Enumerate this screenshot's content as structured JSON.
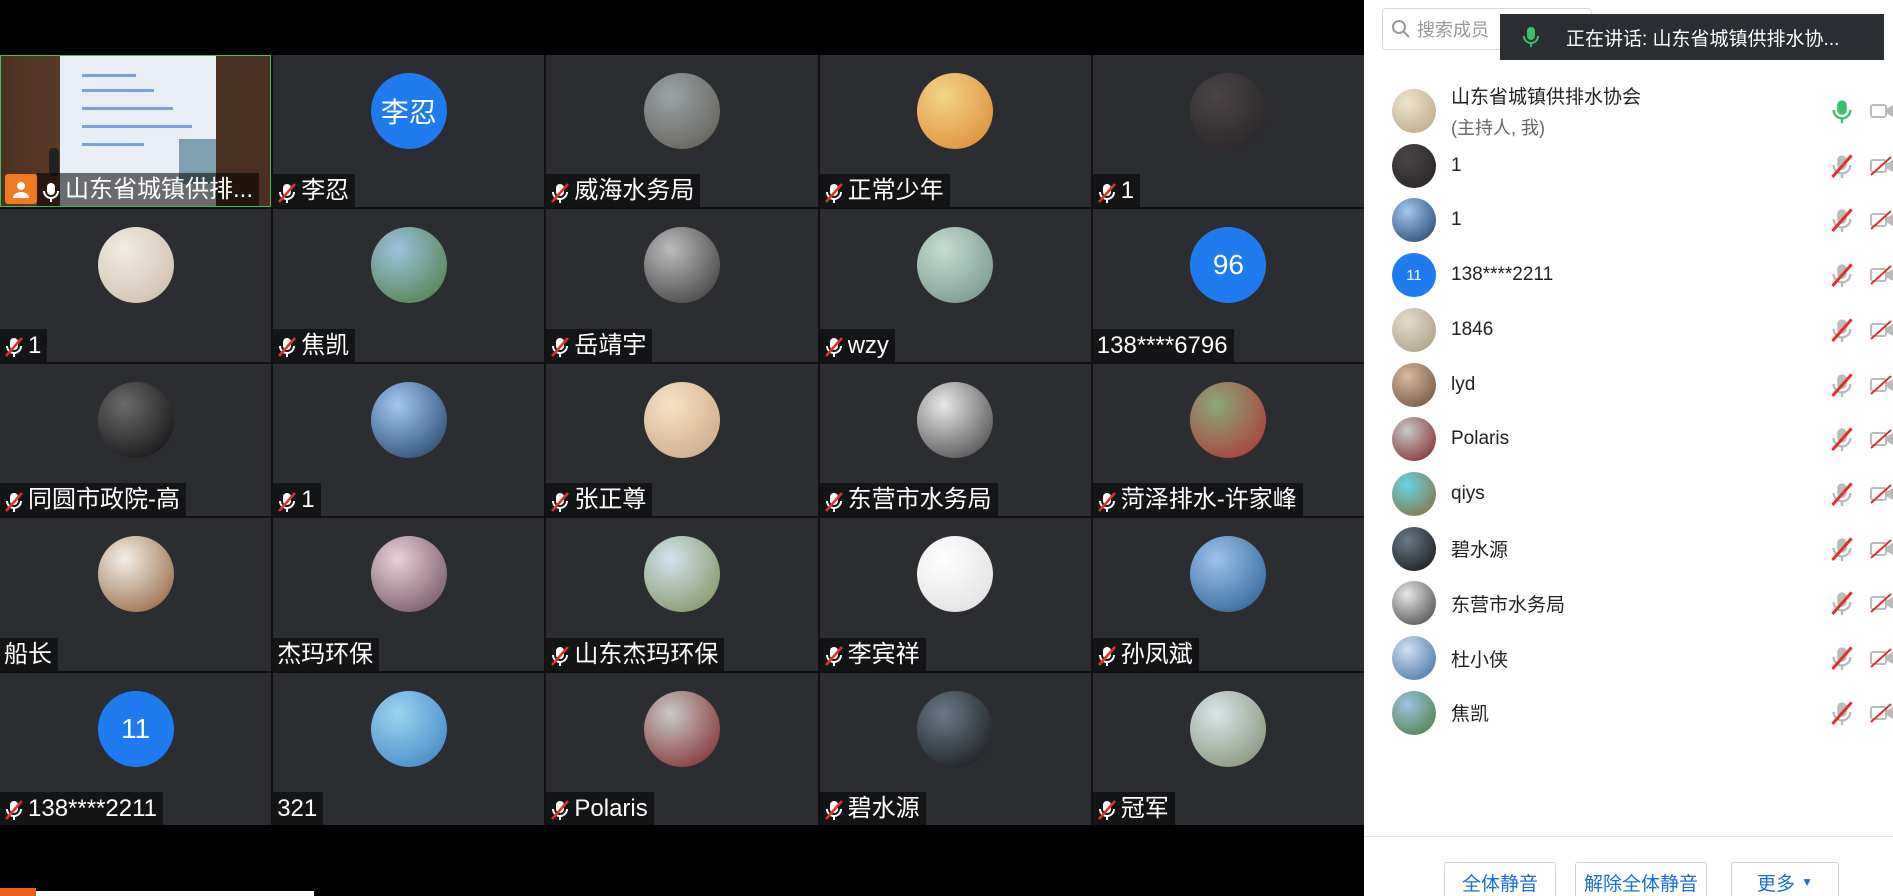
{
  "grid_tiles": [
    {
      "name": "山东省城镇供排...",
      "muted": false,
      "host": true,
      "screen": true
    },
    {
      "name": "李忍",
      "muted": true,
      "avatar_text": "李忍"
    },
    {
      "name": "威海水务局",
      "muted": true,
      "colors": [
        "#9aa3a8",
        "#5d5a4f"
      ]
    },
    {
      "name": "正常少年",
      "muted": true,
      "colors": [
        "#f4d48a",
        "#d9862e"
      ]
    },
    {
      "name": "1",
      "muted": true,
      "colors": [
        "#4a4446",
        "#262223"
      ]
    },
    {
      "name": "1",
      "muted": true,
      "colors": [
        "#f2ece4",
        "#c9b9a7"
      ]
    },
    {
      "name": "焦凯",
      "muted": true,
      "colors": [
        "#9bc2e0",
        "#4a7a3a"
      ]
    },
    {
      "name": "岳靖宇",
      "muted": true,
      "colors": [
        "#bbbbbb",
        "#333333"
      ]
    },
    {
      "name": "wzy",
      "muted": true,
      "colors": [
        "#c6dcd2",
        "#6d8f84"
      ]
    },
    {
      "name": "138****6796",
      "muted": false,
      "avatar_text": "96"
    },
    {
      "name": "同圆市政院-高",
      "muted": true,
      "colors": [
        "#6a6a6a",
        "#0a0a0a"
      ]
    },
    {
      "name": "1",
      "muted": true,
      "colors": [
        "#9fc8ef",
        "#1d3a64"
      ]
    },
    {
      "name": "张正尊",
      "muted": true,
      "colors": [
        "#f7e2c8",
        "#c9a37a"
      ]
    },
    {
      "name": "东营市水务局",
      "muted": true,
      "colors": [
        "#e8e8e8",
        "#3a3a3a"
      ]
    },
    {
      "name": "菏泽排水-许家峰",
      "muted": true,
      "colors": [
        "#8aa77a",
        "#b03030"
      ]
    },
    {
      "name": "船长",
      "muted": false,
      "colors": [
        "#f4efe6",
        "#8a5a32"
      ]
    },
    {
      "name": "杰玛环保",
      "muted": false,
      "colors": [
        "#e5d2d6",
        "#6b4658"
      ]
    },
    {
      "name": "山东杰玛环保",
      "muted": true,
      "colors": [
        "#cfe4ee",
        "#7c8a52"
      ]
    },
    {
      "name": "李宾祥",
      "muted": true,
      "colors": [
        "#ffffff",
        "#dcdcdc"
      ]
    },
    {
      "name": "孙凤斌",
      "muted": true,
      "colors": [
        "#9cc3ec",
        "#235a8e"
      ]
    },
    {
      "name": "138****2211",
      "muted": true,
      "avatar_text": "11"
    },
    {
      "name": "321",
      "muted": false,
      "colors": [
        "#9bd4f0",
        "#3a7fc0"
      ]
    },
    {
      "name": "Polaris",
      "muted": true,
      "colors": [
        "#c8c8c8",
        "#7a1f1f"
      ]
    },
    {
      "name": "碧水源",
      "muted": true,
      "colors": [
        "#6a7a88",
        "#111111"
      ]
    },
    {
      "name": "冠军",
      "muted": true,
      "colors": [
        "#d9e4ea",
        "#7d8a6a"
      ]
    }
  ],
  "panel": {
    "search_placeholder": "搜索成员",
    "speaking_label": "正在讲话: 山东省城镇供排水协...",
    "members": [
      {
        "name": "山东省城镇供排水协会",
        "sub": "(主持人, 我)",
        "colors": [
          "#efe4cf",
          "#b8a37e"
        ],
        "mic_active": true
      },
      {
        "name": "1",
        "colors": [
          "#4a4446",
          "#262223"
        ]
      },
      {
        "name": "1",
        "colors": [
          "#9fc8ef",
          "#1d3a64"
        ]
      },
      {
        "name": "138****2211",
        "avatar_text": "11"
      },
      {
        "name": "1846",
        "colors": [
          "#e4dccb",
          "#a59a80"
        ]
      },
      {
        "name": "lyd",
        "colors": [
          "#d6b99e",
          "#6b4a34"
        ]
      },
      {
        "name": "Polaris",
        "colors": [
          "#c8c8c8",
          "#7a1f1f"
        ]
      },
      {
        "name": "qiys",
        "colors": [
          "#66d4e8",
          "#8a6a2c"
        ]
      },
      {
        "name": "碧水源",
        "colors": [
          "#6a7a88",
          "#111111"
        ]
      },
      {
        "name": "东营市水务局",
        "colors": [
          "#e8e8e8",
          "#3a3a3a"
        ]
      },
      {
        "name": "杜小侠",
        "colors": [
          "#cfe0ef",
          "#3a6aa2"
        ]
      },
      {
        "name": "焦凯",
        "colors": [
          "#9bc2e0",
          "#4a7a3a"
        ]
      }
    ],
    "buttons": {
      "mute_all": "全体静音",
      "unmute_all": "解除全体静音",
      "more": "更多"
    }
  }
}
